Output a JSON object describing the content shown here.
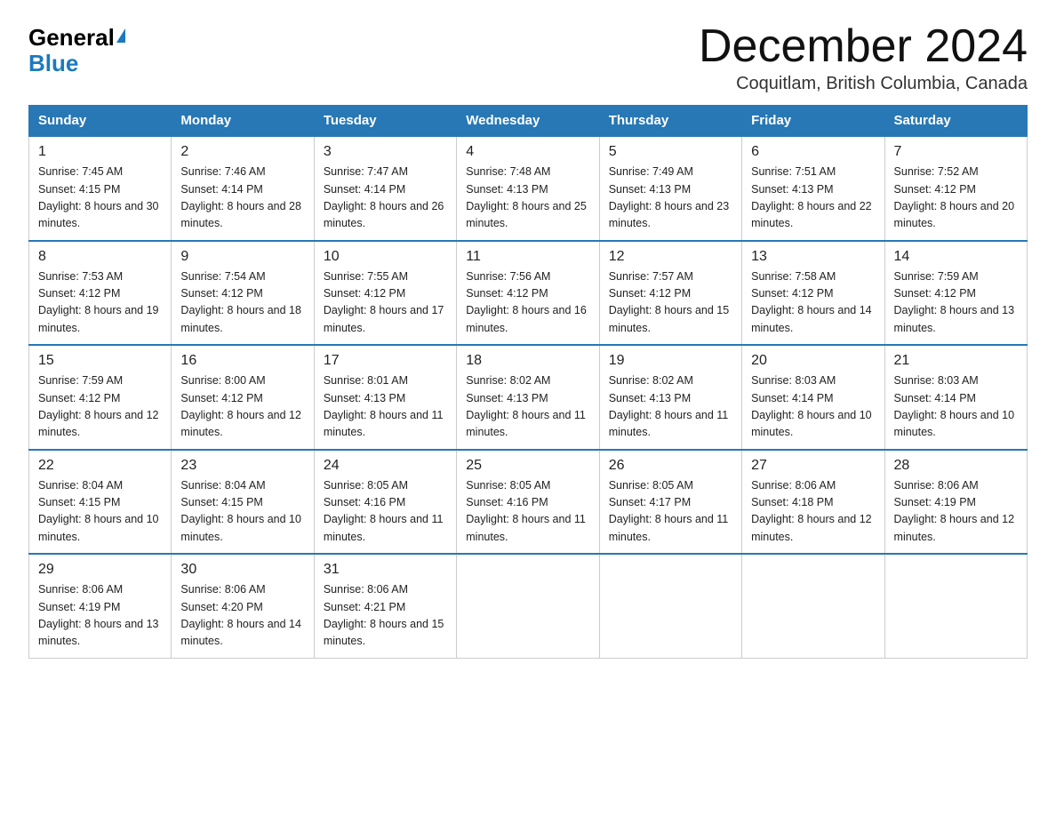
{
  "logo": {
    "general": "General",
    "blue": "Blue"
  },
  "title": {
    "month_year": "December 2024",
    "location": "Coquitlam, British Columbia, Canada"
  },
  "weekdays": [
    "Sunday",
    "Monday",
    "Tuesday",
    "Wednesday",
    "Thursday",
    "Friday",
    "Saturday"
  ],
  "weeks": [
    [
      {
        "day": "1",
        "sunrise": "7:45 AM",
        "sunset": "4:15 PM",
        "daylight": "8 hours and 30 minutes."
      },
      {
        "day": "2",
        "sunrise": "7:46 AM",
        "sunset": "4:14 PM",
        "daylight": "8 hours and 28 minutes."
      },
      {
        "day": "3",
        "sunrise": "7:47 AM",
        "sunset": "4:14 PM",
        "daylight": "8 hours and 26 minutes."
      },
      {
        "day": "4",
        "sunrise": "7:48 AM",
        "sunset": "4:13 PM",
        "daylight": "8 hours and 25 minutes."
      },
      {
        "day": "5",
        "sunrise": "7:49 AM",
        "sunset": "4:13 PM",
        "daylight": "8 hours and 23 minutes."
      },
      {
        "day": "6",
        "sunrise": "7:51 AM",
        "sunset": "4:13 PM",
        "daylight": "8 hours and 22 minutes."
      },
      {
        "day": "7",
        "sunrise": "7:52 AM",
        "sunset": "4:12 PM",
        "daylight": "8 hours and 20 minutes."
      }
    ],
    [
      {
        "day": "8",
        "sunrise": "7:53 AM",
        "sunset": "4:12 PM",
        "daylight": "8 hours and 19 minutes."
      },
      {
        "day": "9",
        "sunrise": "7:54 AM",
        "sunset": "4:12 PM",
        "daylight": "8 hours and 18 minutes."
      },
      {
        "day": "10",
        "sunrise": "7:55 AM",
        "sunset": "4:12 PM",
        "daylight": "8 hours and 17 minutes."
      },
      {
        "day": "11",
        "sunrise": "7:56 AM",
        "sunset": "4:12 PM",
        "daylight": "8 hours and 16 minutes."
      },
      {
        "day": "12",
        "sunrise": "7:57 AM",
        "sunset": "4:12 PM",
        "daylight": "8 hours and 15 minutes."
      },
      {
        "day": "13",
        "sunrise": "7:58 AM",
        "sunset": "4:12 PM",
        "daylight": "8 hours and 14 minutes."
      },
      {
        "day": "14",
        "sunrise": "7:59 AM",
        "sunset": "4:12 PM",
        "daylight": "8 hours and 13 minutes."
      }
    ],
    [
      {
        "day": "15",
        "sunrise": "7:59 AM",
        "sunset": "4:12 PM",
        "daylight": "8 hours and 12 minutes."
      },
      {
        "day": "16",
        "sunrise": "8:00 AM",
        "sunset": "4:12 PM",
        "daylight": "8 hours and 12 minutes."
      },
      {
        "day": "17",
        "sunrise": "8:01 AM",
        "sunset": "4:13 PM",
        "daylight": "8 hours and 11 minutes."
      },
      {
        "day": "18",
        "sunrise": "8:02 AM",
        "sunset": "4:13 PM",
        "daylight": "8 hours and 11 minutes."
      },
      {
        "day": "19",
        "sunrise": "8:02 AM",
        "sunset": "4:13 PM",
        "daylight": "8 hours and 11 minutes."
      },
      {
        "day": "20",
        "sunrise": "8:03 AM",
        "sunset": "4:14 PM",
        "daylight": "8 hours and 10 minutes."
      },
      {
        "day": "21",
        "sunrise": "8:03 AM",
        "sunset": "4:14 PM",
        "daylight": "8 hours and 10 minutes."
      }
    ],
    [
      {
        "day": "22",
        "sunrise": "8:04 AM",
        "sunset": "4:15 PM",
        "daylight": "8 hours and 10 minutes."
      },
      {
        "day": "23",
        "sunrise": "8:04 AM",
        "sunset": "4:15 PM",
        "daylight": "8 hours and 10 minutes."
      },
      {
        "day": "24",
        "sunrise": "8:05 AM",
        "sunset": "4:16 PM",
        "daylight": "8 hours and 11 minutes."
      },
      {
        "day": "25",
        "sunrise": "8:05 AM",
        "sunset": "4:16 PM",
        "daylight": "8 hours and 11 minutes."
      },
      {
        "day": "26",
        "sunrise": "8:05 AM",
        "sunset": "4:17 PM",
        "daylight": "8 hours and 11 minutes."
      },
      {
        "day": "27",
        "sunrise": "8:06 AM",
        "sunset": "4:18 PM",
        "daylight": "8 hours and 12 minutes."
      },
      {
        "day": "28",
        "sunrise": "8:06 AM",
        "sunset": "4:19 PM",
        "daylight": "8 hours and 12 minutes."
      }
    ],
    [
      {
        "day": "29",
        "sunrise": "8:06 AM",
        "sunset": "4:19 PM",
        "daylight": "8 hours and 13 minutes."
      },
      {
        "day": "30",
        "sunrise": "8:06 AM",
        "sunset": "4:20 PM",
        "daylight": "8 hours and 14 minutes."
      },
      {
        "day": "31",
        "sunrise": "8:06 AM",
        "sunset": "4:21 PM",
        "daylight": "8 hours and 15 minutes."
      },
      null,
      null,
      null,
      null
    ]
  ]
}
